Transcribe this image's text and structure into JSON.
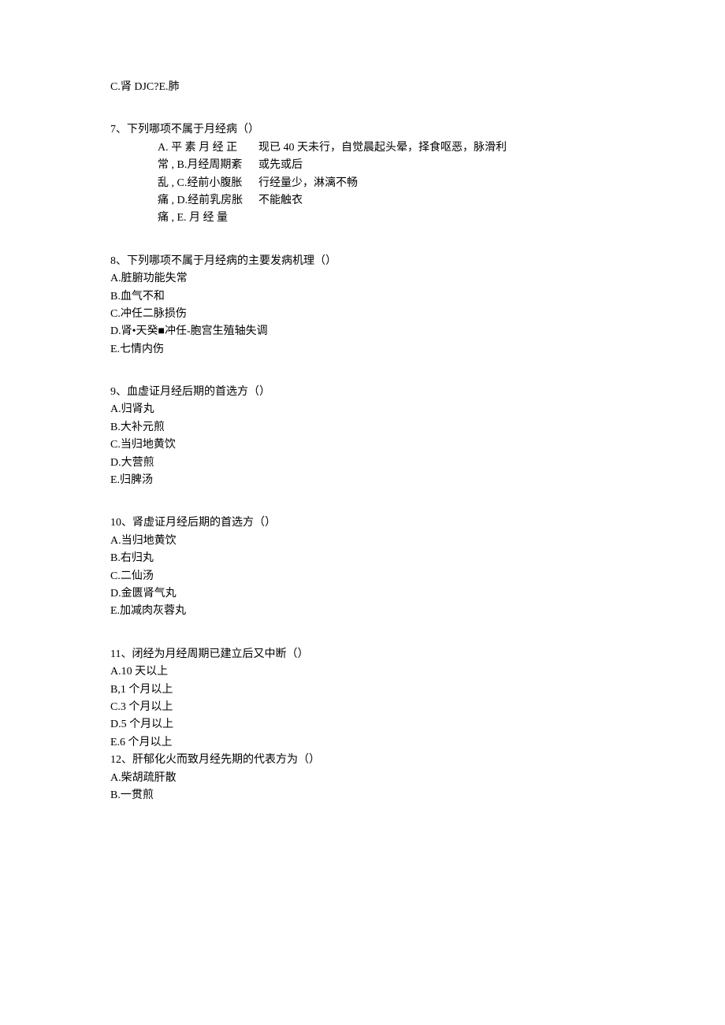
{
  "line_c": "C.肾 DJC?E.肺",
  "q7": {
    "stem": "7、下列哪项不属于月经病（）",
    "rows": [
      {
        "left": "A. 平 素 月 经 正",
        "right": "现已 40 天未行，自觉晨起头晕，择食呕恶，脉滑利"
      },
      {
        "left": "常 , B.月经周期紊",
        "right": "或先或后"
      },
      {
        "left": "乱 , C.经前小腹胀",
        "right": "行经量少，淋漓不畅"
      },
      {
        "left": "痛 , D.经前乳房胀",
        "right": "不能触衣"
      },
      {
        "left": "痛  , E.  月  经  量",
        "right": ""
      }
    ]
  },
  "q8": {
    "stem": "8、下列哪项不属于月经病的主要发病机理（）",
    "options": [
      "A.脏腑功能失常",
      "B.血气不和",
      "C.冲任二脉损伤",
      "D.肾•天癸■冲任-胞宫生殖轴失调",
      "E.七情内伤"
    ]
  },
  "q9": {
    "stem": "9、血虚证月经后期的首选方（）",
    "options": [
      "A.归肾丸",
      "B.大补元煎",
      "C.当归地黄饮",
      "D.大营煎",
      "E.归脾汤"
    ]
  },
  "q10": {
    "stem": "10、肾虚证月经后期的首选方（）",
    "options": [
      "A.当归地黄饮",
      "B.右归丸",
      "C.二仙汤",
      "D.金匮肾气丸",
      "E.加减肉灰蓉丸"
    ]
  },
  "q11": {
    "stem": "11、闭经为月经周期已建立后又中断（）",
    "options": [
      "A.10 天以上",
      "B,1 个月以上",
      "C.3 个月以上",
      "D.5 个月以上",
      "E.6 个月以上"
    ]
  },
  "q12": {
    "stem": "12、肝郁化火而致月经先期的代表方为（）",
    "options": [
      "A.柴胡疏肝散",
      "B.一贯煎"
    ]
  }
}
